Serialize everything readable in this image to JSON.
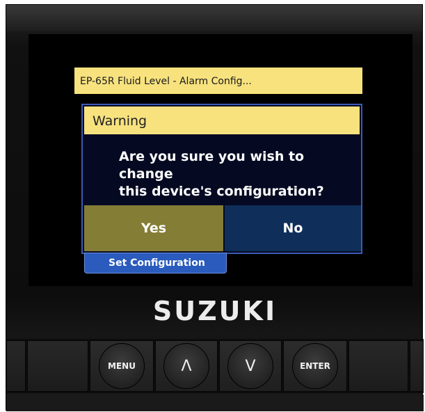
{
  "window": {
    "title": "EP-65R Fluid Level - Alarm Config..."
  },
  "dialog": {
    "header": "Warning",
    "message_line1": "Are you sure you wish to change",
    "message_line2": "this device's configuration?",
    "yes_label": "Yes",
    "no_label": "No"
  },
  "tab": {
    "label": "Set Configuration"
  },
  "brand": {
    "logo_text": "SUZUKI"
  },
  "keypad": {
    "menu_label": "MENU",
    "up_symbol": "Λ",
    "down_symbol": "V",
    "enter_label": "ENTER"
  },
  "colors": {
    "title_bar": "#f7e27e",
    "yes_button": "#847d35",
    "no_button": "#0f2f5a",
    "dialog_border": "#3b5bb5",
    "tab": "#2a5bbd"
  }
}
